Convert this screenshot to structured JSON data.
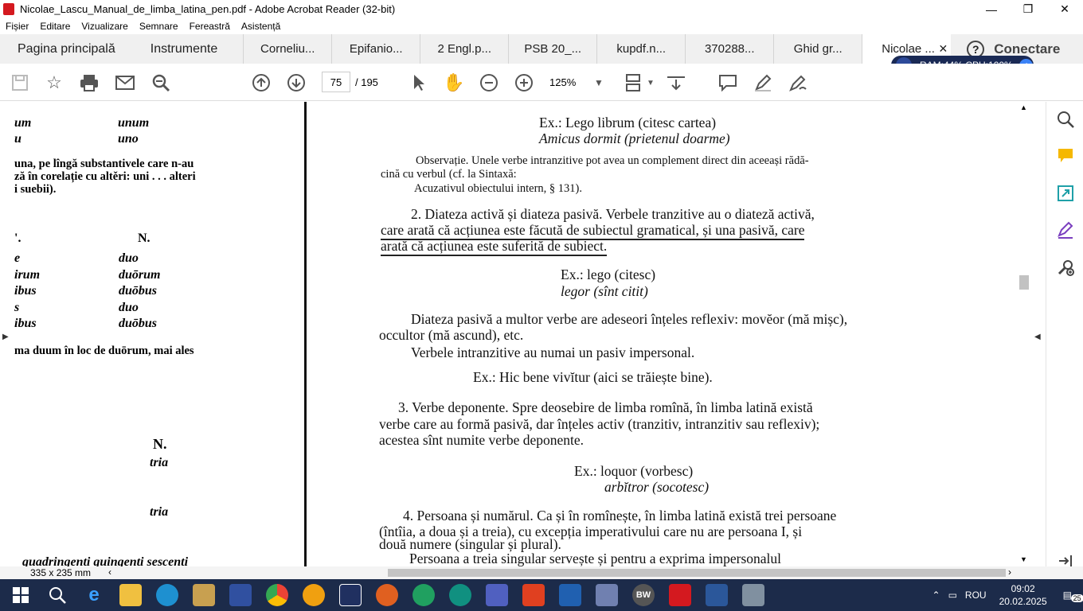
{
  "window": {
    "title": "Nicolae_Lascu_Manual_de_limba_latina_pen.pdf - Adobe Acrobat Reader (32-bit)",
    "minimize": "—",
    "maximize": "❐",
    "close": "✕"
  },
  "menu": [
    "Fișier",
    "Editare",
    "Vizualizare",
    "Semnare",
    "Fereastră",
    "Asistență"
  ],
  "tabs": {
    "home": "Pagina principală",
    "tools": "Instrumente",
    "docs": [
      "Corneliu...",
      "Epifanio...",
      "2 Engl.p...",
      "PSB 20_...",
      "kupdf.n...",
      "370288...",
      "Ghid gr...",
      "Nicolae ..."
    ],
    "close_symbol": "✕",
    "help": "?",
    "connect": "Conectare"
  },
  "sysmon": {
    "text": "RAM:44% CPU:100%"
  },
  "toolbar": {
    "page_current": "75",
    "page_total": "/ 195",
    "zoom": "125%"
  },
  "left_page": {
    "row1": [
      "um",
      "unum"
    ],
    "row2": [
      "u",
      "uno"
    ],
    "para1_l1": "una, pe lîngă substantivele care n-au",
    "para1_l2": "ză în corelație cu altěri: uni . . . alteri",
    "para1_l3": "i suebii).",
    "header_l": "'.",
    "header_r": "N.",
    "decl": [
      [
        "e",
        "duo"
      ],
      [
        "irum",
        "duōrum"
      ],
      [
        "ibus",
        "duōbus"
      ],
      [
        "s",
        "duo"
      ],
      [
        "ibus",
        "duōbus"
      ]
    ],
    "note": "ma duum în loc de duōrum, mai ales",
    "n2": "N.",
    "tria1": "tria",
    "tria2": "tria",
    "bottom": "quadringenti quingenti sescenti"
  },
  "right_page": {
    "ex1_l1": "Ex.: Lego librum (citesc cartea)",
    "ex1_l2": "Amicus dormit (prietenul doarme)",
    "obs_l1": "Observație. Unele verbe intranzitive pot avea un complement direct din aceeași rădă-",
    "obs_l2": "cină cu verbul (cf. la Sintaxă:",
    "obs_l3": "Acuzativul obiectului intern, § 131).",
    "p2_l1": "2. Diateza activă și diateza pasivă. Verbele tranzitive au o diateză activă,",
    "p2_l2": "care arată că acțiunea este făcută de subiectul gramatical, și una pasivă, care",
    "p2_l3": "arată că acțiunea este suferită de subiect.",
    "ex2_l1": "Ex.: lego (citesc)",
    "ex2_l2": "legor (sînt citit)",
    "p3_l1": "Diateza pasivă a multor verbe are adeseori înțeles reflexiv: movĕor (mă mișc),",
    "p3_l2": "occultor (mă ascund), etc.",
    "p3_l3": "Verbele intranzitive au numai un pasiv impersonal.",
    "ex3": "Ex.: Hic bene vivĭtur (aici se trăiește bine).",
    "p4_l1": "3. Verbe deponente. Spre deosebire de limba romînă, în limba latină există",
    "p4_l2": "verbe care au formă pasivă, dar înțeles activ (tranzitiv, intranzitiv sau reflexiv);",
    "p4_l3": "acestea sînt numite verbe deponente.",
    "ex4_l1": "Ex.: loquor (vorbesc)",
    "ex4_l2": "arbĭtror (socotesc)",
    "p5_l1": "4. Persoana și numărul. Ca și în romînește, în limba latină există trei persoane",
    "p5_l2": "(întîia, a doua și a treia), cu excepția imperativului care nu are persoana I, și",
    "p5_l3": "două numere (singular și plural).",
    "p5_l4": "Persoana a treia singular servește și pentru a exprima impersonalul"
  },
  "status": {
    "page_size": "335 x 235 mm"
  },
  "taskbar": {
    "lang": "ROU",
    "time": "09:02",
    "date": "20.02.2025",
    "notif": "25",
    "bw": "BW"
  },
  "colors": {
    "taskbar": "#1c2b4a",
    "acrobat_red": "#d4191f",
    "sysmon_bg": "#1a2a55"
  }
}
